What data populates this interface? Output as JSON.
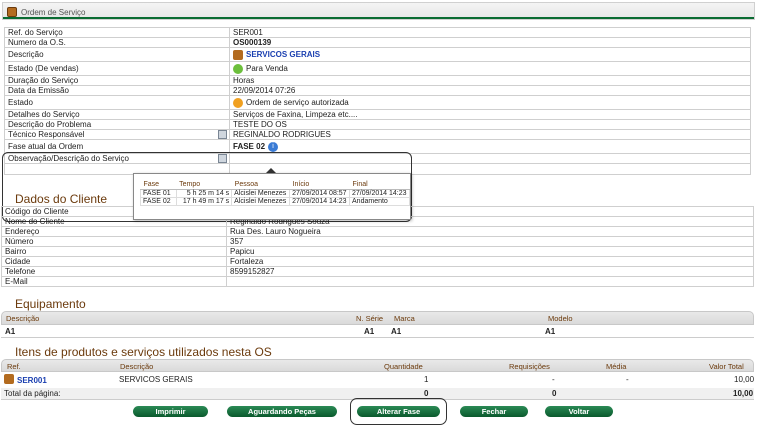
{
  "header": {
    "title": "Ordem de Serviço"
  },
  "os_fields": [
    {
      "label": "Ref. do Serviço",
      "value": "SER001"
    },
    {
      "label": "Numero da O.S.",
      "value": "OS000139"
    },
    {
      "label": "Descrição",
      "value": "SERVICOS GERAIS"
    },
    {
      "label": "Estado (De vendas)",
      "value": "Para Venda"
    },
    {
      "label": "Duração do Serviço",
      "value": "Horas"
    },
    {
      "label": "Data da Emissão",
      "value": "22/09/2014 07:26"
    },
    {
      "label": "Estado",
      "value": "Ordem de serviço autorizada"
    },
    {
      "label": "Detalhes do Serviço",
      "value": "Serviços de Faxina, Limpeza etc...."
    },
    {
      "label": "Descrição do Problema",
      "value": "TESTE DO OS"
    },
    {
      "label": "Técnico Responsável",
      "value": "REGINALDO RODRIGUES"
    },
    {
      "label": "Fase atual da Ordem",
      "value": "FASE 02"
    },
    {
      "label": "Observação/Descrição do Serviço",
      "value": ""
    }
  ],
  "phase_popup": {
    "headers": [
      "Fase",
      "Tempo",
      "Pessoa",
      "Início",
      "Final"
    ],
    "rows": [
      [
        "FASE 01",
        "5 h 25 m 14 s",
        "Alcislei Menezes",
        "27/09/2014 08:57",
        "27/09/2014 14:23"
      ],
      [
        "FASE 02",
        "17 h 49 m 17 s",
        "Alcislei Menezes",
        "27/09/2014 14:23",
        "Andamento"
      ]
    ]
  },
  "client": {
    "title": "Dados do Cliente",
    "fields": [
      {
        "label": "Código do Cliente",
        "value": ""
      },
      {
        "label": "Nome do Cliente",
        "value": "Reginaldo Rodrigues Souza"
      },
      {
        "label": "Endereço",
        "value": "Rua Des. Lauro Nogueira"
      },
      {
        "label": "Número",
        "value": "357"
      },
      {
        "label": "Bairro",
        "value": "Papicu"
      },
      {
        "label": "Cidade",
        "value": "Fortaleza"
      },
      {
        "label": "Telefone",
        "value": "8599152827"
      },
      {
        "label": "E-Mail",
        "value": ""
      }
    ]
  },
  "equipment": {
    "title": "Equipamento",
    "headers": {
      "desc": "Descrição",
      "serial": "N. Série",
      "brand": "Marca",
      "model": "Modelo"
    },
    "row": {
      "desc": "A1",
      "serial": "A1",
      "brand": "A1",
      "model": "A1"
    }
  },
  "items": {
    "title": "Itens de produtos e serviços utilizados nesta OS",
    "headers": {
      "ref": "Ref.",
      "desc": "Descrição",
      "qty": "Quantidade",
      "req": "Requisições",
      "avg": "Média",
      "total": "Valor Total"
    },
    "row": {
      "ref": "SER001",
      "desc": "SERVICOS GERAIS",
      "qty": "1",
      "req": "-",
      "avg": "-",
      "total": "10,00"
    },
    "footer": {
      "label": "Total da página:",
      "qty": "0",
      "req": "0",
      "total": "10,00"
    }
  },
  "buttons": {
    "print": "Imprimir",
    "waiting": "Aguardando Peças",
    "change_phase": "Alterar Fase",
    "close": "Fechar",
    "back": "Voltar"
  },
  "colors": {
    "accent_green": "#0a5a2d",
    "section_brown": "#6b3a0c",
    "link_blue": "#1a3fb0"
  }
}
